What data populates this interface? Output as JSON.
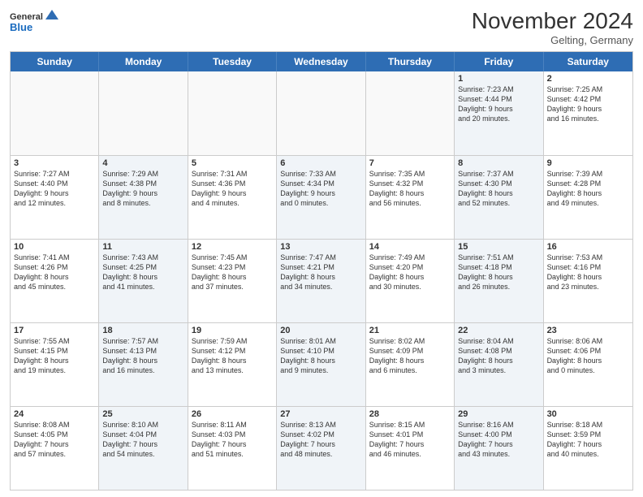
{
  "logo": {
    "line1": "General",
    "line2": "Blue"
  },
  "title": "November 2024",
  "location": "Gelting, Germany",
  "days_of_week": [
    "Sunday",
    "Monday",
    "Tuesday",
    "Wednesday",
    "Thursday",
    "Friday",
    "Saturday"
  ],
  "weeks": [
    [
      {
        "num": "",
        "info": "",
        "empty": true
      },
      {
        "num": "",
        "info": "",
        "empty": true
      },
      {
        "num": "",
        "info": "",
        "empty": true
      },
      {
        "num": "",
        "info": "",
        "empty": true
      },
      {
        "num": "",
        "info": "",
        "empty": true
      },
      {
        "num": "1",
        "info": "Sunrise: 7:23 AM\nSunset: 4:44 PM\nDaylight: 9 hours\nand 20 minutes.",
        "shaded": true
      },
      {
        "num": "2",
        "info": "Sunrise: 7:25 AM\nSunset: 4:42 PM\nDaylight: 9 hours\nand 16 minutes.",
        "shaded": false
      }
    ],
    [
      {
        "num": "3",
        "info": "Sunrise: 7:27 AM\nSunset: 4:40 PM\nDaylight: 9 hours\nand 12 minutes.",
        "shaded": false
      },
      {
        "num": "4",
        "info": "Sunrise: 7:29 AM\nSunset: 4:38 PM\nDaylight: 9 hours\nand 8 minutes.",
        "shaded": true
      },
      {
        "num": "5",
        "info": "Sunrise: 7:31 AM\nSunset: 4:36 PM\nDaylight: 9 hours\nand 4 minutes.",
        "shaded": false
      },
      {
        "num": "6",
        "info": "Sunrise: 7:33 AM\nSunset: 4:34 PM\nDaylight: 9 hours\nand 0 minutes.",
        "shaded": true
      },
      {
        "num": "7",
        "info": "Sunrise: 7:35 AM\nSunset: 4:32 PM\nDaylight: 8 hours\nand 56 minutes.",
        "shaded": false
      },
      {
        "num": "8",
        "info": "Sunrise: 7:37 AM\nSunset: 4:30 PM\nDaylight: 8 hours\nand 52 minutes.",
        "shaded": true
      },
      {
        "num": "9",
        "info": "Sunrise: 7:39 AM\nSunset: 4:28 PM\nDaylight: 8 hours\nand 49 minutes.",
        "shaded": false
      }
    ],
    [
      {
        "num": "10",
        "info": "Sunrise: 7:41 AM\nSunset: 4:26 PM\nDaylight: 8 hours\nand 45 minutes.",
        "shaded": false
      },
      {
        "num": "11",
        "info": "Sunrise: 7:43 AM\nSunset: 4:25 PM\nDaylight: 8 hours\nand 41 minutes.",
        "shaded": true
      },
      {
        "num": "12",
        "info": "Sunrise: 7:45 AM\nSunset: 4:23 PM\nDaylight: 8 hours\nand 37 minutes.",
        "shaded": false
      },
      {
        "num": "13",
        "info": "Sunrise: 7:47 AM\nSunset: 4:21 PM\nDaylight: 8 hours\nand 34 minutes.",
        "shaded": true
      },
      {
        "num": "14",
        "info": "Sunrise: 7:49 AM\nSunset: 4:20 PM\nDaylight: 8 hours\nand 30 minutes.",
        "shaded": false
      },
      {
        "num": "15",
        "info": "Sunrise: 7:51 AM\nSunset: 4:18 PM\nDaylight: 8 hours\nand 26 minutes.",
        "shaded": true
      },
      {
        "num": "16",
        "info": "Sunrise: 7:53 AM\nSunset: 4:16 PM\nDaylight: 8 hours\nand 23 minutes.",
        "shaded": false
      }
    ],
    [
      {
        "num": "17",
        "info": "Sunrise: 7:55 AM\nSunset: 4:15 PM\nDaylight: 8 hours\nand 19 minutes.",
        "shaded": false
      },
      {
        "num": "18",
        "info": "Sunrise: 7:57 AM\nSunset: 4:13 PM\nDaylight: 8 hours\nand 16 minutes.",
        "shaded": true
      },
      {
        "num": "19",
        "info": "Sunrise: 7:59 AM\nSunset: 4:12 PM\nDaylight: 8 hours\nand 13 minutes.",
        "shaded": false
      },
      {
        "num": "20",
        "info": "Sunrise: 8:01 AM\nSunset: 4:10 PM\nDaylight: 8 hours\nand 9 minutes.",
        "shaded": true
      },
      {
        "num": "21",
        "info": "Sunrise: 8:02 AM\nSunset: 4:09 PM\nDaylight: 8 hours\nand 6 minutes.",
        "shaded": false
      },
      {
        "num": "22",
        "info": "Sunrise: 8:04 AM\nSunset: 4:08 PM\nDaylight: 8 hours\nand 3 minutes.",
        "shaded": true
      },
      {
        "num": "23",
        "info": "Sunrise: 8:06 AM\nSunset: 4:06 PM\nDaylight: 8 hours\nand 0 minutes.",
        "shaded": false
      }
    ],
    [
      {
        "num": "24",
        "info": "Sunrise: 8:08 AM\nSunset: 4:05 PM\nDaylight: 7 hours\nand 57 minutes.",
        "shaded": false
      },
      {
        "num": "25",
        "info": "Sunrise: 8:10 AM\nSunset: 4:04 PM\nDaylight: 7 hours\nand 54 minutes.",
        "shaded": true
      },
      {
        "num": "26",
        "info": "Sunrise: 8:11 AM\nSunset: 4:03 PM\nDaylight: 7 hours\nand 51 minutes.",
        "shaded": false
      },
      {
        "num": "27",
        "info": "Sunrise: 8:13 AM\nSunset: 4:02 PM\nDaylight: 7 hours\nand 48 minutes.",
        "shaded": true
      },
      {
        "num": "28",
        "info": "Sunrise: 8:15 AM\nSunset: 4:01 PM\nDaylight: 7 hours\nand 46 minutes.",
        "shaded": false
      },
      {
        "num": "29",
        "info": "Sunrise: 8:16 AM\nSunset: 4:00 PM\nDaylight: 7 hours\nand 43 minutes.",
        "shaded": true
      },
      {
        "num": "30",
        "info": "Sunrise: 8:18 AM\nSunset: 3:59 PM\nDaylight: 7 hours\nand 40 minutes.",
        "shaded": false
      }
    ]
  ]
}
